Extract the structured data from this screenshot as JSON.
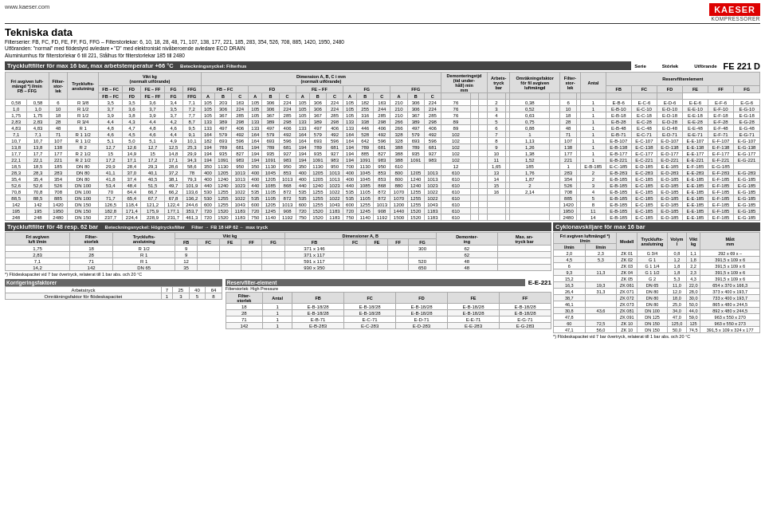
{
  "header": {
    "website": "www.kaeser.com",
    "brand": "KAESER",
    "brand_sub": "KOMPRESSORER"
  },
  "title": "Tekniska data",
  "description_line1": "Filterserier: FB, FC, FD, FE, FF, FG, FFG – Filterstorlekar: 6, 10, 18, 28, 48, 71, 107, 138, 177, 221, 185, 283, 354, 526, 708, 885, 1420, 1950, 2480",
  "description_line2": "Utföranden: \"normal\" med flödestyrd avledare • \"D\" med elektroniskt nivåberoende avledare ECO DRAIN",
  "description_line3": "Aluminiumhus för filterstorlekar 6 till 221, Stålhus för filterstorlekar 185 till 2480",
  "main_filter_section": {
    "title": "Tryckluftfilter för max 16 bar, max arbetstemperatur +66 °C",
    "subtitle": "Beteckningsnyckel: Filterhus",
    "model": "FE 221 D",
    "korrigering_title": "Korrigeringsfaktorer",
    "reservfilter_title": "Reservfilterelement",
    "reservfilter_code": "E-E-221",
    "col_headers": [
      "FB – FFG",
      "Filter-storlek",
      "Trycklufts-anslutning",
      "FB – FC",
      "FD",
      "FE – FF",
      "FG",
      "FFG",
      "FB – FC",
      "FD",
      "FE – FF",
      "FG",
      "FFG",
      "FD",
      "FE – FF",
      "FG",
      "FFG",
      "Demonteringstjd",
      "Arbetstryck",
      "Omräkningsfaktor",
      "Filter-storlek",
      "Antal",
      "FB",
      "FC",
      "FD",
      "FE",
      "FF",
      "FG"
    ],
    "rows": [
      [
        "0,58",
        "6",
        "R 3/8",
        "3,5",
        "3,5",
        "3,6",
        "3,4",
        "7,1",
        "105, 203, 163",
        "105, 306, 224",
        "105, 306, 224",
        "105, 182, 163",
        "210, 306, 224",
        "76",
        "2",
        "0,38",
        "6",
        "1",
        "E-B-6",
        "E-C-6",
        "E-D-6",
        "E-E-6",
        "E-F-6",
        "E-G-6"
      ],
      [
        "1,0",
        "10",
        "R 1/2",
        "3,7",
        "3,6",
        "3,7",
        "3,5",
        "7,2",
        "105, 306, 224",
        "105, 306, 224",
        "105, 306, 224",
        "105, 255, 244",
        "210, 306, 224",
        "76",
        "3",
        "0,52",
        "10",
        "1",
        "E-B-10",
        "E-C-10",
        "E-D-10",
        "E-E-10",
        "E-F-10",
        "E-G-10"
      ],
      [
        "1,75",
        "18",
        "R 1/2",
        "3,9",
        "3,8",
        "3,9",
        "3,7",
        "7,7",
        "105, 367, 285",
        "105, 367, 285",
        "105, 367, 285",
        "105, 316, 285",
        "210, 367, 285",
        "76",
        "4",
        "0,63",
        "18",
        "1",
        "E-B-18",
        "E-C-18",
        "E-D-18",
        "E-E-18",
        "E-F-18",
        "E-G-18"
      ],
      [
        "2,83",
        "28",
        "R 3/4",
        "4,4",
        "4,3",
        "4,4",
        "4,2",
        "8,7",
        "133, 389, 298",
        "133, 389, 298",
        "133, 389, 298",
        "133, 338, 298",
        "266, 389, 298",
        "89",
        "5",
        "0,75",
        "28",
        "1",
        "E-B-28",
        "E-C-28",
        "E-D-28",
        "E-E-28",
        "E-F-28",
        "E-G-28"
      ],
      [
        "4,83",
        "48",
        "R 1",
        "4,8",
        "4,7",
        "4,8",
        "4,6",
        "9,5",
        "133, 497, 406",
        "133, 497, 406",
        "133, 497, 406",
        "133, 446, 406",
        "266, 497, 406",
        "89",
        "6",
        "0,88",
        "48",
        "1",
        "E-B-48",
        "E-C-48",
        "E-D-48",
        "E-E-48",
        "E-F-48",
        "E-G-48"
      ],
      [
        "7,1",
        "71",
        "R 1 1/2",
        "4,6",
        "4,5",
        "4,6",
        "4,4",
        "9,1",
        "164, 579, 492",
        "164, 579, 492",
        "164, 579, 492",
        "164, 528, 492",
        "328, 579, 492",
        "102",
        "7",
        "1",
        "71",
        "1",
        "E-B-71",
        "E-C-71",
        "E-D-71",
        "E-E-71",
        "E-F-71",
        "E-G-71"
      ],
      [
        "10,7",
        "107",
        "R 1 1/2",
        "5,1",
        "5,0",
        "5,1",
        "4,9",
        "10,1",
        "182, 693, 596",
        "164, 693, 596",
        "164, 693, 596",
        "164, 642, 596",
        "328, 693, 596",
        "102",
        "8",
        "1,13",
        "107",
        "1",
        "E-B-107",
        "E-C-107",
        "E-D-107",
        "E-E-107",
        "E-F-107",
        "E-G-107"
      ],
      [
        "13,8",
        "138",
        "R 2",
        "12,7",
        "12,6",
        "12,7",
        "12,5",
        "25,3",
        "194, 789, 681",
        "194, 789, 681",
        "194, 789, 681",
        "194, 789, 681",
        "388, 789, 681",
        "102",
        "9",
        "1,26",
        "138",
        "1",
        "E-B-138",
        "E-C-138",
        "E-D-138",
        "E-E-138",
        "E-F-138",
        "E-G-138"
      ],
      [
        "17,7",
        "177",
        "R 2 1/2",
        "15",
        "14,9",
        "15",
        "14,8",
        "29,9",
        "194, 935, 827",
        "194, 935, 927",
        "194, 935, 927",
        "194, 885, 827",
        "388, 935, 927",
        "102",
        "10",
        "1,38",
        "177",
        "1",
        "E-B-177",
        "E-C-177",
        "E-D-177",
        "E-E-177",
        "E-F-177",
        "E-G-177"
      ],
      [
        "22,1",
        "221",
        "R 2 1/2",
        "17,2",
        "17,1",
        "17,2",
        "17,1",
        "34,3",
        "194, 1091, 983",
        "194, 1091, 983",
        "194, 1091, 983",
        "194, 1091, 983",
        "388, 1091, 983",
        "102",
        "11",
        "1,52",
        "221",
        "1",
        "E-B-221",
        "E-C-221",
        "E-D-221",
        "E-E-221",
        "E-F-221",
        "E-G-221"
      ],
      [
        "18,5",
        "185",
        "DN 80",
        "29,9",
        "28,4",
        "29,3",
        "28,6",
        "58,6",
        "350, 1130, 950",
        "350, 1130, 950",
        "350, 1130, 950",
        "700, 1130, 950",
        "610",
        "12",
        "1,65",
        "185",
        "1",
        "E-B-185",
        "E-C-185",
        "E-D-185",
        "E-E-185",
        "E-F-185",
        "E-G-185"
      ],
      [
        "28,3",
        "283",
        "DN 80",
        "41,1",
        "37,0",
        "40,1",
        "37,2",
        "78",
        "400, 1205, 1013",
        "400, 1045, 853",
        "400, 1205, 1013",
        "400, 1045, 853",
        "800, 1205, 1013",
        "610",
        "13",
        "1,76",
        "283",
        "2",
        "E-B-283",
        "E-C-283",
        "E-D-283",
        "E-E-283",
        "E-F-283",
        "E-G-283"
      ],
      [
        "35,4",
        "354",
        "DN 80",
        "41,8",
        "37,4",
        "40,5",
        "38,1",
        "79,3",
        "400, 1240, 1013",
        "400, 1205, 1013",
        "400, 1205, 1013",
        "400, 1045, 853",
        "800, 1240, 1013",
        "610",
        "14",
        "1,87",
        "354",
        "2",
        "E-B-185",
        "E-C-185",
        "E-D-185",
        "E-E-185",
        "E-F-185",
        "E-G-185"
      ],
      [
        "52,6",
        "526",
        "DN 100",
        "53,4",
        "48,4",
        "51,5",
        "49,7",
        "101,9",
        "440, 1240, 1023",
        "440, 1085, 868",
        "440, 1240, 1023",
        "440, 1085, 868",
        "880, 1240, 1023",
        "610",
        "15",
        "2",
        "526",
        "3",
        "E-B-185",
        "E-C-185",
        "E-D-185",
        "E-E-185",
        "E-F-185",
        "E-G-185"
      ],
      [
        "70,8",
        "708",
        "DN 100",
        "70",
        "64,4",
        "66,7",
        "66,2",
        "133,6",
        "530, 1255, 1022",
        "535, 1105, 872",
        "535, 1255, 1022",
        "535, 1105, 872",
        "1070, 1255, 1022",
        "610",
        "16",
        "2,14",
        "708",
        "4",
        "E-B-185",
        "E-C-185",
        "E-D-185",
        "E-E-185",
        "E-F-185",
        "E-G-185"
      ],
      [
        "88,5",
        "885",
        "DN 100",
        "71,7",
        "65,4",
        "67,7",
        "67,8",
        "136,2",
        "530, 1255, 1022",
        "535, 1105, 872",
        "535, 1255, 1022",
        "535, 1105, 872",
        "1070, 1255, 1022",
        "610",
        "",
        "",
        "885",
        "5",
        "E-B-185",
        "E-C-185",
        "E-D-185",
        "E-E-185",
        "E-F-185",
        "E-G-185"
      ],
      [
        "142",
        "1420",
        "DN 150",
        "126,5",
        "118,4",
        "121,2",
        "122,4",
        "244,6",
        "600, 1255, 1043",
        "600, 1205, 1013",
        "600, 1255, 1043",
        "600, 1255, 1013",
        "1200, 1255, 1043",
        "610",
        "",
        "",
        "1420",
        "8",
        "E-B-185",
        "E-C-185",
        "E-D-185",
        "E-E-185",
        "E-F-185",
        "E-G-185"
      ],
      [
        "195",
        "1950",
        "DN 150",
        "182,8",
        "171,4",
        "175,9",
        "177,1",
        "353,7",
        "720, 1520, 1183",
        "720, 1245, 908",
        "720, 1520, 1183",
        "720, 1245, 908",
        "1440, 1520, 1183",
        "610",
        "",
        "",
        "1950",
        "11",
        "E-B-185",
        "E-C-185",
        "E-D-185",
        "E-E-185",
        "E-F-185",
        "E-G-185"
      ],
      [
        "248",
        "2480",
        "DN 150",
        "237,7",
        "224,4",
        "228,9",
        "231,7",
        "461,3",
        "720, 1520, 1183",
        "750, 1140, 1192",
        "750, 1520, 1183",
        "750, 1140, 1192",
        "1500, 1520, 1183",
        "610",
        "",
        "",
        "2480",
        "14",
        "E-B-185",
        "E-C-185",
        "E-D-185",
        "E-E-185",
        "E-F-185",
        "E-G-185"
      ]
    ]
  },
  "bottom_left": {
    "filter48_title": "Tryckluftfilter för 48 resp. 62 bar",
    "filter48_subtitle": "Beteckningsnyckel: Högtrycksfilter",
    "filter48_note": "Filter → FB 18 HP 62 ← max tryck",
    "filter48_headers": [
      "Fri avgiven luft l/min",
      "Filter-storlek",
      "Trycklufts-anslutning",
      "FB",
      "FC",
      "FE",
      "FF",
      "FG",
      "FB",
      "FC",
      "FE",
      "FF",
      "FG",
      "Demontering",
      "Max. arb. tryck bar"
    ],
    "filter48_rows": [
      [
        "1,75",
        "18",
        "R 1/2",
        "9",
        "",
        "",
        "",
        "",
        "371 x 146",
        "",
        "",
        "",
        "300",
        "62"
      ],
      [
        "2,83",
        "28",
        "R 1",
        "9",
        "",
        "",
        "",
        "",
        "371 x 117",
        "",
        "",
        "",
        "",
        "62"
      ],
      [
        "7,1",
        "71",
        "R 1",
        "12",
        "",
        "",
        "",
        "",
        "591 x 117",
        "",
        "",
        "",
        "520",
        "48"
      ],
      [
        "14,2",
        "142",
        "DN 65",
        "35",
        "",
        "",
        "",
        "",
        "930 x 350",
        "",
        "",
        "",
        "650",
        "48"
      ]
    ],
    "footnote": "*) Flödeskapacitet vid 7 bar övertryck, relaterat till 1 bar abs. och 20 °C",
    "korrigering_sub_title": "Korrigeringsfaktorer",
    "korrigering_sub": "Arbetstryck: 7  25  40  64",
    "omrakning_sub": "Omräkningsfaktor för flödeskapacitet: 1  3  5  8",
    "reservfilter_sub_title": "Reservfilter-element",
    "reservfilter_sub_code": "E-E-221",
    "reservfilter_sub_note": "Filterstorlek: High Pressure",
    "reservfilter_sub_headers": [
      "Filter-storlek",
      "Antal",
      "FB",
      "FC",
      "FD",
      "FE",
      "FF"
    ],
    "reservfilter_sub_rows": [
      [
        "18",
        "1",
        "E-B-18/28",
        "E-B-18/28",
        "E-B-18/28",
        "E-B-18/28",
        "E-B-18/28"
      ],
      [
        "28",
        "1",
        "E-B-18/28",
        "E-B-18/28",
        "E-B-18/28",
        "E-B-18/28",
        "E-B-18/28"
      ],
      [
        "71",
        "1",
        "E-B-71",
        "E-C-71",
        "E-D-71",
        "E-E-71",
        "E-G-71"
      ],
      [
        "142",
        "1",
        "E-B-283",
        "E-C-283",
        "E-D-283",
        "E-E-283",
        "E-G-283"
      ]
    ]
  },
  "cyclo_section": {
    "title": "Cyklonavskiljare för max 16 bar",
    "subtitle": "Fri avgiven luftmängd *) l/min",
    "headers": [
      "l/min",
      "l/min",
      "Modell",
      "Tryckluftsanslutning",
      "Volym l",
      "Vikt kg",
      "Mått mm"
    ],
    "rows": [
      [
        "2,0",
        "2,3",
        "ZK 01",
        "G 3/4",
        "0,8",
        "1,1",
        "292 x 69 x –"
      ],
      [
        "4,5",
        "5,3",
        "ZK 02",
        "G 1",
        "1,2",
        "1,8",
        "391,5 x 109 x 6"
      ],
      [
        "6",
        "",
        "ZK 03",
        "G 1 1/4",
        "1,8",
        "2,2",
        "391,5 x 109 x 6"
      ],
      [
        "9,3",
        "11,3",
        "ZK 04",
        "G 1 1/2",
        "1,8",
        "2,3",
        "391,5 x 109 x 6"
      ],
      [
        "15,2",
        "",
        "ZK 05",
        "G 2",
        "5,3",
        "4,3",
        "391,5 x 109 x 6"
      ],
      [
        "16,3",
        "19,3",
        "ZK 061",
        "DN 65",
        "11,0",
        "22,0",
        "654 x 370 x 166,3"
      ],
      [
        "26,4",
        "31,3",
        "ZK 071",
        "DN 80",
        "12,0",
        "28,0",
        "373 x 400 x 193,7"
      ],
      [
        "38,7",
        "",
        "ZK 072",
        "DN 80",
        "18,0",
        "30,0",
        "733 x 400 x 193,7"
      ],
      [
        "46,1",
        "",
        "ZK 073",
        "DN 80",
        "25,0",
        "50,0",
        "865 x 480 x 244,5"
      ],
      [
        "30,8",
        "43,6",
        "ZK 081",
        "DN 100",
        "34,0",
        "44,0",
        "892 x 480 x 244,5"
      ],
      [
        "47,8",
        "",
        "ZK 091",
        "DN 125",
        "47,0",
        "59,0",
        "963 x 550 x 270"
      ],
      [
        "60",
        "72,5",
        "ZK 10",
        "DN 150",
        "125,0",
        "125",
        "963 x 550 x 273"
      ],
      [
        "47,1",
        "56,0",
        "ZK 10",
        "DN 150",
        "50,0",
        "74,5",
        "391,5 x 109 x 324 x 177"
      ]
    ],
    "footnote": "*) Flödeskapacitet vid 7 bar övertryck, relaterat till 1 bar abs. och 20 °C"
  }
}
